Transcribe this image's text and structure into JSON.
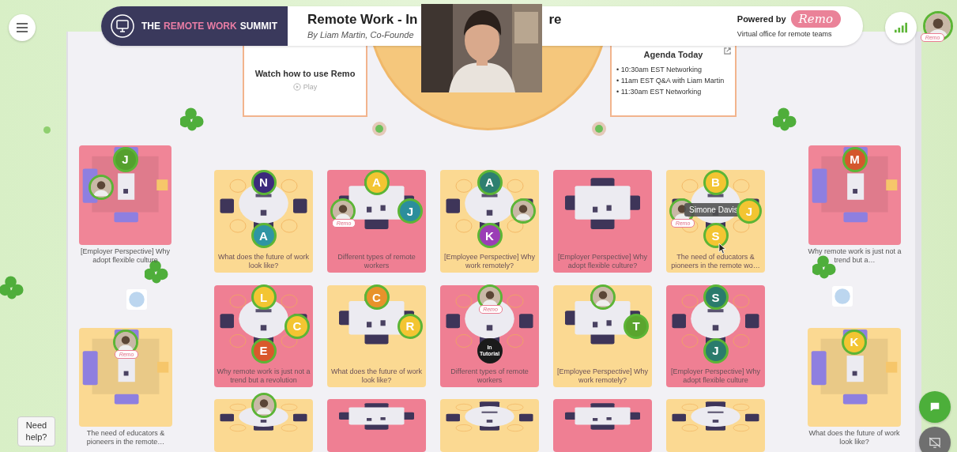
{
  "header": {
    "logo_parts": [
      {
        "text": "THE",
        "accent": false
      },
      {
        "text": "REMOTE WORK",
        "accent": true
      },
      {
        "text": "SUMMIT",
        "accent": false
      }
    ],
    "event_title_parts": [
      "Remote Work - In",
      "re"
    ],
    "event_subtitle": "By Liam Martin, Co-Founde",
    "powered_by": "Powered by",
    "brand": "Remo",
    "tagline": "Virtual office for remote teams"
  },
  "user": {
    "badge": "Remo"
  },
  "watch_card": {
    "title": "Watch how to use Remo",
    "action": "Play"
  },
  "agenda": {
    "title": "Agenda Today",
    "items": [
      "• 10:30am EST Networking",
      "• 11am EST Q&A with Liam Martin",
      "• 11:30am EST Networking"
    ]
  },
  "tables": [
    {
      "kind": "lounge",
      "color": "#f08597",
      "label": "[Employer Perspective] Why adopt flexible culture",
      "seats": {
        "top": {
          "kind": "initial",
          "initial": "J",
          "color": "#55a02e"
        }
      }
    },
    {
      "kind": "round",
      "color": "#fbd992",
      "label": "What does the future of work look like?",
      "seats": {
        "top": {
          "kind": "initial",
          "initial": "N",
          "color": "#3c2a7c"
        },
        "bottom": {
          "kind": "initial",
          "initial": "A",
          "color": "#2f95a3"
        }
      }
    },
    {
      "kind": "rect",
      "color": "#ef7f93",
      "label": "Different types of remote workers",
      "seats": {
        "top": {
          "kind": "initial",
          "initial": "A",
          "color": "#f3c532"
        },
        "left": {
          "badge": "Remo"
        },
        "right": {
          "kind": "initial",
          "initial": "J",
          "color": "#2c8e9c"
        }
      }
    },
    {
      "kind": "round",
      "color": "#fbd992",
      "label": "[Employee Perspective] Why work remotely?",
      "seats": {
        "top": {
          "kind": "initial",
          "initial": "A",
          "color": "#2e7f70"
        },
        "bottom": {
          "kind": "initial",
          "initial": "K",
          "color": "#9b3db6"
        }
      }
    },
    {
      "kind": "rect",
      "color": "#ef7f93",
      "label": "[Employer Perspective] Why adopt flexible culture?"
    },
    {
      "kind": "round",
      "color": "#fbd992",
      "label": "The need of educators & pioneers in the remote wo…",
      "seats": {
        "top": {
          "kind": "initial",
          "initial": "B",
          "color": "#f3c532"
        },
        "left": {
          "badge": "Remo",
          "tooltip": "Simone Davis"
        },
        "right": {
          "kind": "initial",
          "initial": "J",
          "color": "#f3c532"
        },
        "bottom": {
          "kind": "initial",
          "initial": "S",
          "color": "#f3c532"
        }
      }
    },
    {
      "kind": "lounge",
      "color": "#f08597",
      "label": "Why remote work is just not a trend but a…",
      "seats": {
        "top": {
          "kind": "initial",
          "initial": "M",
          "color": "#d4572c"
        }
      }
    },
    {
      "kind": "lounge",
      "color": "#fbd992",
      "label": "The need of educators & pioneers in the remote…",
      "seats": {
        "top": {
          "badge": "Remo"
        }
      }
    },
    {
      "kind": "round",
      "color": "#ef7f93",
      "label": "Why remote work is just not a trend but a revolution",
      "seats": {
        "top": {
          "kind": "initial",
          "initial": "L",
          "color": "#f3c532"
        },
        "right": {
          "kind": "initial",
          "initial": "C",
          "color": "#f3c532"
        },
        "bottom": {
          "kind": "initial",
          "initial": "E",
          "color": "#d9582b"
        }
      }
    },
    {
      "kind": "rect",
      "color": "#fbd992",
      "label": "What does the future of work look like?",
      "seats": {
        "top": {
          "kind": "initial",
          "initial": "C",
          "color": "#e8922b"
        },
        "right": {
          "kind": "initial",
          "initial": "R",
          "color": "#f3c532"
        }
      }
    },
    {
      "kind": "round",
      "color": "#ef7f93",
      "label": "Different types of remote workers",
      "seats": {
        "top": {
          "badge": "Remo"
        },
        "bottom": {
          "kind": "status",
          "text": "In Tutorial"
        }
      }
    },
    {
      "kind": "rect",
      "color": "#fbd992",
      "label": "[Employee Perspective] Why work remotely?",
      "seats": {
        "right": {
          "kind": "initial",
          "initial": "T",
          "color": "#5aa52e"
        }
      }
    },
    {
      "kind": "round",
      "color": "#ef7f93",
      "label": "[Employer Perspective] Why adopt flexible culture",
      "seats": {
        "top": {
          "kind": "initial",
          "initial": "S",
          "color": "#2a7b6c"
        },
        "bottom": {
          "kind": "initial",
          "initial": "J",
          "color": "#2a7b6c"
        }
      }
    },
    {
      "kind": "lounge",
      "color": "#fbd992",
      "label": "What does the future of work look like?",
      "seats": {
        "top": {
          "kind": "initial",
          "initial": "K",
          "color": "#f3c532"
        }
      }
    },
    {
      "kind": "round",
      "color": "#fbd992"
    },
    {
      "kind": "rect",
      "color": "#ef7f93"
    },
    {
      "kind": "round",
      "color": "#fbd992"
    },
    {
      "kind": "rect",
      "color": "#ef7f93"
    },
    {
      "kind": "round",
      "color": "#fbd992"
    }
  ],
  "help": {
    "text": "Need help?"
  }
}
